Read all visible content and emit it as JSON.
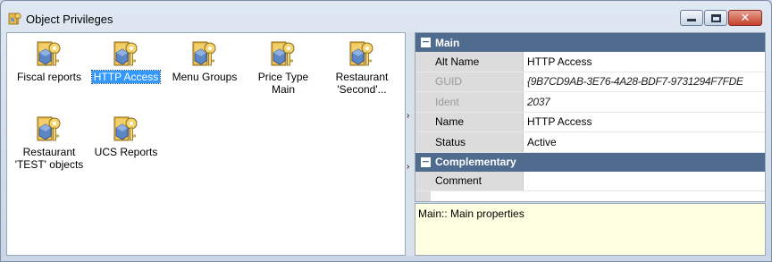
{
  "window": {
    "title": "Object Privileges",
    "icon": "privileges-key-icon",
    "controls": {
      "minimize": "minimize-icon",
      "maximize": "maximize-icon",
      "close_glyph": "✕"
    }
  },
  "objects": [
    {
      "label_lines": [
        "Fiscal reports"
      ],
      "icon": "object-key-icon",
      "selected": false
    },
    {
      "label_lines": [
        "HTTP Access"
      ],
      "icon": "object-key-icon",
      "selected": true
    },
    {
      "label_lines": [
        "Menu Groups"
      ],
      "icon": "object-key-icon",
      "selected": false
    },
    {
      "label_lines": [
        "Price Type",
        "Main"
      ],
      "icon": "object-key-icon",
      "selected": false
    },
    {
      "label_lines": [
        "Restaurant",
        "'Second'..."
      ],
      "icon": "object-key-icon",
      "selected": false
    },
    {
      "label_lines": [
        "Restaurant",
        "'TEST' objects"
      ],
      "icon": "object-key-icon",
      "selected": false
    },
    {
      "label_lines": [
        "UCS Reports"
      ],
      "icon": "object-key-icon",
      "selected": false
    }
  ],
  "splitter": {
    "arrow_top": "›",
    "arrow_bottom": "›"
  },
  "properties": {
    "categories": [
      {
        "name": "Main",
        "toggle": "−",
        "rows": [
          {
            "name": "Alt Name",
            "value": "HTTP Access",
            "disabled": false,
            "italic": false
          },
          {
            "name": "GUID",
            "value": "{9B7CD9AB-3E76-4A28-BDF7-9731294F7FDE",
            "disabled": true,
            "italic": true
          },
          {
            "name": "Ident",
            "value": "2037",
            "disabled": true,
            "italic": true
          },
          {
            "name": "Name",
            "value": "HTTP Access",
            "disabled": false,
            "italic": false
          },
          {
            "name": "Status",
            "value": "Active",
            "disabled": false,
            "italic": false
          }
        ]
      },
      {
        "name": "Complementary",
        "toggle": "−",
        "rows": [
          {
            "name": "Comment",
            "value": "",
            "disabled": false,
            "italic": false
          }
        ]
      }
    ]
  },
  "description": "Main:: Main properties",
  "colors": {
    "category_header": "#4f6b8e",
    "selection": "#3399ff",
    "description_bg": "#ffffe1"
  }
}
